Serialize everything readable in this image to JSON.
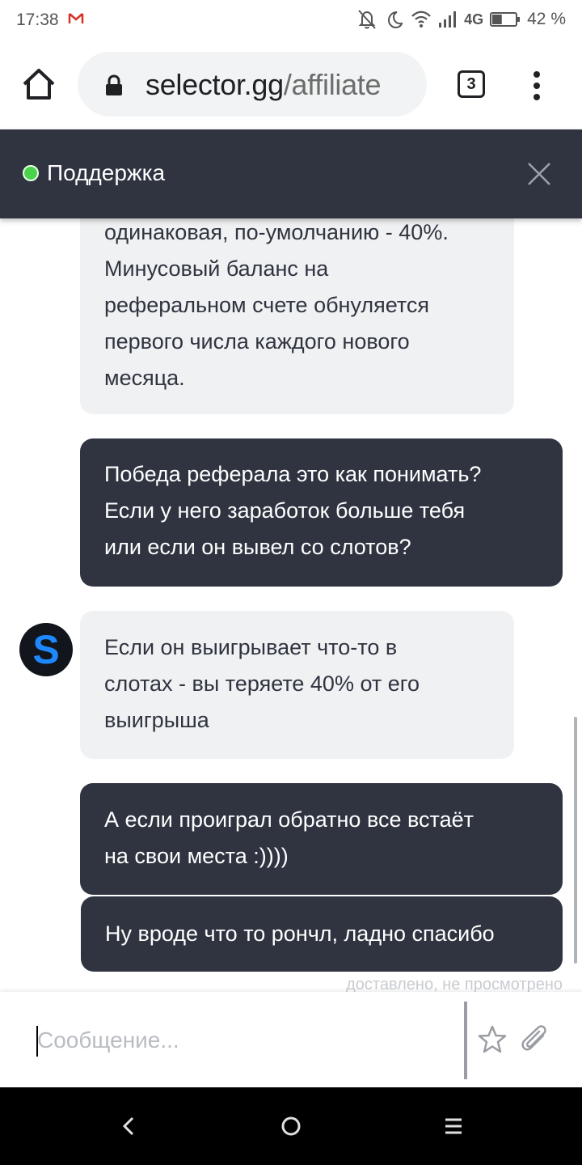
{
  "status_bar": {
    "time": "17:38",
    "network": "4G",
    "battery": "42 %",
    "battery_level": 0.42
  },
  "browser": {
    "url_main": "selector.gg",
    "url_path": "/affiliate",
    "tab_count": "3"
  },
  "chat": {
    "title": "Поддержка",
    "online": true,
    "avatar_letter": "S",
    "messages": [
      {
        "from": "support",
        "text": "одинаковая, по-умолчанию - 40%.\nМинусовый баланс на\nреферальном счете обнуляется\nпервого числа каждого нового\nмесяца."
      },
      {
        "from": "user",
        "text": "Победа реферала это как понимать?\nЕсли у него заработок больше тебя\nили если он вывел со слотов?"
      },
      {
        "from": "support",
        "text": "Если он выигрывает что-то в\nслотах - вы теряете 40% от его\nвыигрыша"
      },
      {
        "from": "user",
        "text": "А если проиграл обратно все встаёт\nна свои места :))))"
      },
      {
        "from": "user",
        "text": "Ну вроде что то рончл, ладно спасибо"
      }
    ],
    "delivery_status": "доставлено, не просмотрено"
  },
  "composer": {
    "placeholder": "Сообщение..."
  },
  "colors": {
    "header_bg": "#2f3440",
    "outgoing_bubble": "#2f3440",
    "incoming_bubble": "#f0f1f3",
    "online_dot": "#4cd34c",
    "avatar_letter": "#1e88ff"
  }
}
